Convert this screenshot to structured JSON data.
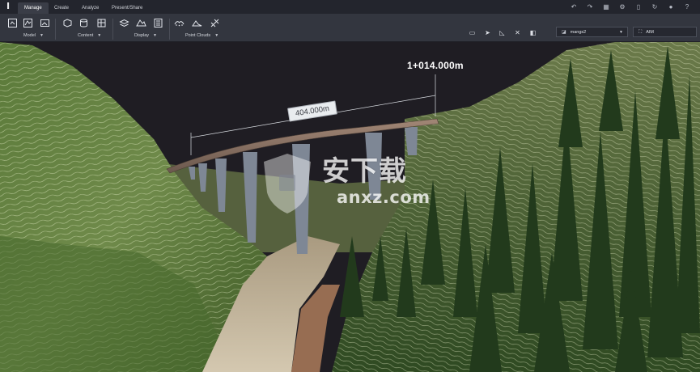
{
  "tabs": [
    {
      "label": "Manage",
      "active": true
    },
    {
      "label": "Create",
      "active": false
    },
    {
      "label": "Analyze",
      "active": false
    },
    {
      "label": "Present/Share",
      "active": false
    }
  ],
  "ribbon": {
    "groups": [
      {
        "label": "Model"
      },
      {
        "label": "Content"
      },
      {
        "label": "Display"
      },
      {
        "label": "Point Clouds"
      }
    ]
  },
  "toolbar_right": {
    "proposal_dropdown": {
      "value": "mangs2"
    },
    "view_dropdown": {
      "value": "AIM"
    }
  },
  "viewport": {
    "distance_label": "404.000m",
    "station_label": "1+014.000m"
  },
  "watermark": {
    "text": "安下载",
    "subtext": "anxz.com"
  },
  "colors": {
    "titlebar": "#23252d",
    "ribbon": "#33363f",
    "active_tab": "#3a3d47",
    "sky": "#1e1d22",
    "bridge_deck": "#7d6a5e",
    "piers": "#7e8795"
  },
  "icons": [
    "app-logo-icon",
    "undo-icon",
    "redo-icon",
    "layout-icon",
    "settings-icon",
    "document-icon",
    "refresh-icon",
    "chat-icon",
    "help-icon"
  ]
}
